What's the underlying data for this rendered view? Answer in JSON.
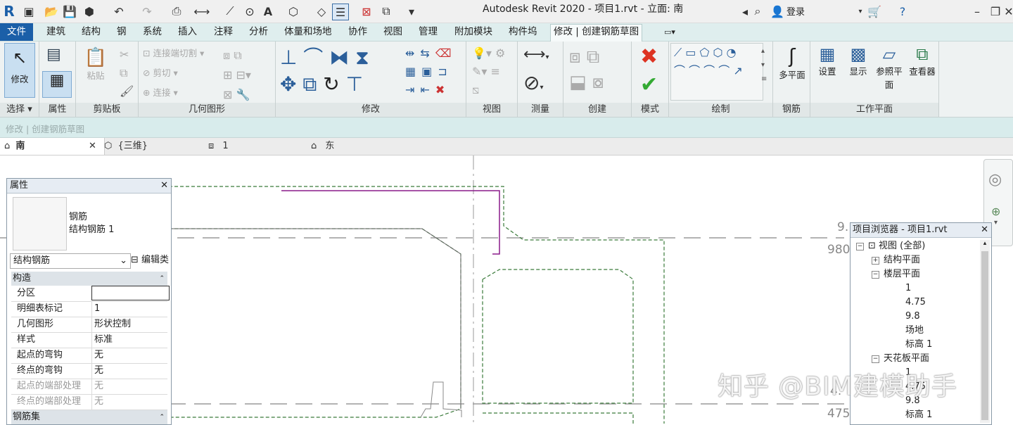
{
  "app": {
    "title": "Autodesk Revit 2020 - 项目1.rvt - 立面: 南",
    "login_label": "登录"
  },
  "tabs": [
    "文件",
    "建筑",
    "结构",
    "钢",
    "系统",
    "插入",
    "注释",
    "分析",
    "体量和场地",
    "协作",
    "视图",
    "管理",
    "附加模块",
    "构件坞",
    "修改 | 创建钢筋草图"
  ],
  "ribbon": {
    "select": {
      "modify_label": "修改",
      "panel_label": "选择"
    },
    "properties": {
      "panel_label": "属性"
    },
    "clipboard": {
      "paste_label": "粘贴",
      "panel_label": "剪贴板"
    },
    "geometry": {
      "join_cut_label": "连接端切割",
      "cut_label": "剪切",
      "join_label": "连接",
      "panel_label": "几何图形"
    },
    "modify": {
      "panel_label": "修改"
    },
    "view": {
      "panel_label": "视图"
    },
    "measure": {
      "panel_label": "测量"
    },
    "create": {
      "panel_label": "创建"
    },
    "mode": {
      "panel_label": "模式"
    },
    "draw": {
      "panel_label": "绘制"
    },
    "rebar": {
      "multiplane_label": "多平面",
      "panel_label": "钢筋"
    },
    "workplane": {
      "set_label": "设置",
      "show_label": "显示",
      "ref_plane_label": "参照平面",
      "viewer_label": "查看器",
      "panel_label": "工作平面"
    }
  },
  "options_bar": {
    "text": "修改 | 创建钢筋草图"
  },
  "view_tabs": [
    {
      "label": "南"
    },
    {
      "label": "{三维}"
    },
    {
      "label": "1"
    },
    {
      "label": "东"
    }
  ],
  "properties": {
    "title": "属性",
    "type_name": "钢筋",
    "type_sub": "结构钢筋 1",
    "selector_value": "结构钢筋",
    "edit_type_label": "编辑类",
    "section_construct": "构造",
    "rows": [
      {
        "key": "分区",
        "value": ""
      },
      {
        "key": "明细表标记",
        "value": "1"
      },
      {
        "key": "几何图形",
        "value": "形状控制"
      },
      {
        "key": "样式",
        "value": "标准"
      },
      {
        "key": "起点的弯钩",
        "value": "无"
      },
      {
        "key": "终点的弯钩",
        "value": "无"
      },
      {
        "key": "起点的端部处理",
        "value": "无"
      },
      {
        "key": "终点的端部处理",
        "value": "无"
      }
    ],
    "section_set": "钢筋集"
  },
  "browser": {
    "title": "项目浏览器 - 项目1.rvt",
    "views_root": "视图 (全部)",
    "struct_plan": "结构平面",
    "floor_plan": "楼层平面",
    "floor_items": [
      "1",
      "4.75",
      "9.8",
      "场地",
      "标高 1"
    ],
    "ceiling_plan": "天花板平面",
    "ceiling_items": [
      "1",
      "4.75",
      "9.8",
      "标高 1"
    ]
  },
  "canvas": {
    "level_labels": [
      "9.",
      "980",
      "4.",
      "475"
    ]
  },
  "watermark": "知乎 @BIM建模助手",
  "colors": {
    "file_tab": "#1b5fa8",
    "ribbon_bg": "#eef2f2",
    "tab_bg": "#dfeeee",
    "rebar_line": "#8a1a8a",
    "dashed_green": "#3a7a3a"
  }
}
